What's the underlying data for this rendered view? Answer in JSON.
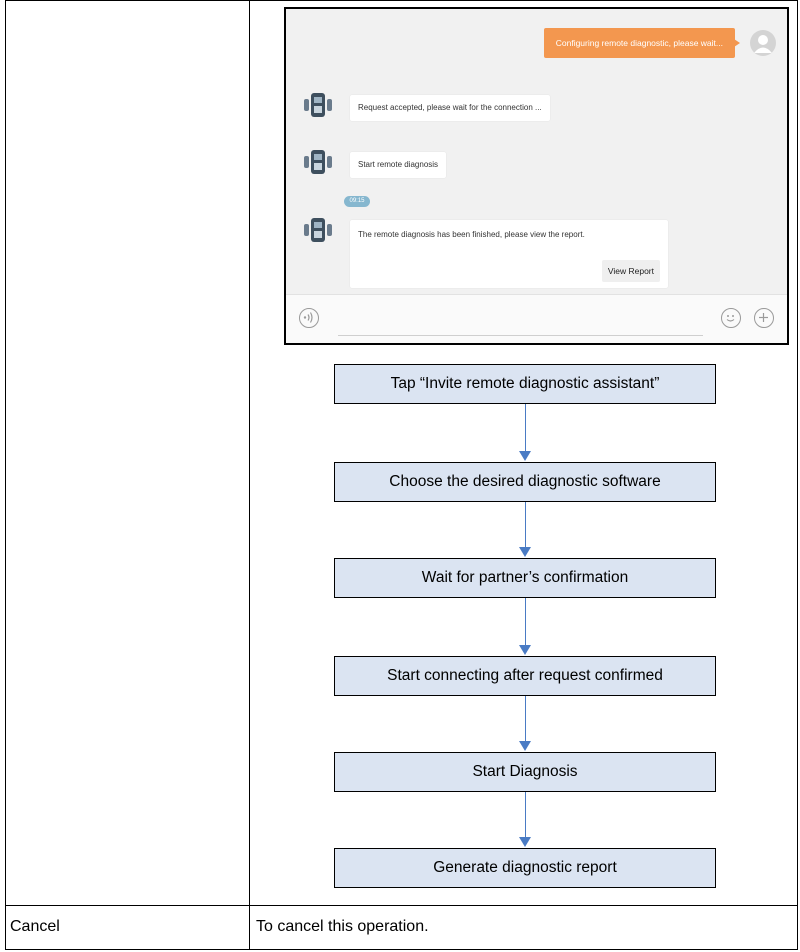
{
  "chat": {
    "outgoing_message": "Configuring remote diagnostic, please wait...",
    "messages": [
      "Request accepted, please wait for the connection ...",
      "Start remote diagnosis",
      "The remote diagnosis has been finished, please view the report."
    ],
    "timestamp": "09:15",
    "view_report_label": "View Report"
  },
  "flow_steps": [
    "Tap “Invite remote diagnostic assistant”",
    "Choose the desired diagnostic software",
    "Wait for partner’s confirmation",
    "Start connecting after request confirmed",
    "Start Diagnosis",
    "Generate diagnostic report"
  ],
  "table": {
    "row_label": "Cancel",
    "row_description": "To cancel this operation."
  },
  "colors": {
    "outgoing_bubble": "#f3974f",
    "flow_box": "#dbe4f2",
    "flow_arrow": "#4a7bc4"
  }
}
